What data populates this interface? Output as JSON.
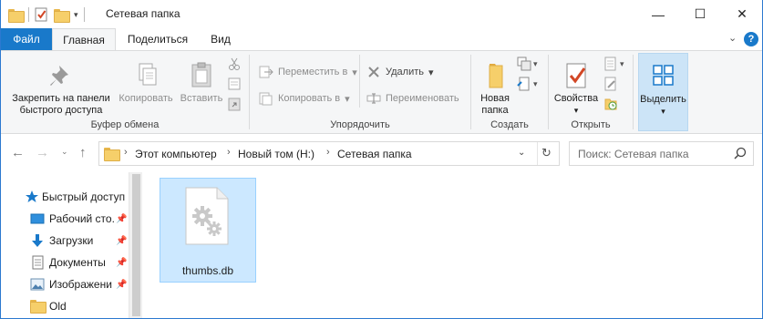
{
  "window": {
    "title": "Сетевая папка",
    "controls": {
      "minimize": "—",
      "maximize": "☐",
      "close": "✕"
    }
  },
  "ribbon": {
    "tabs": [
      "Файл",
      "Главная",
      "Поделиться",
      "Вид"
    ],
    "help_glyph": "?",
    "clipboard": {
      "pin": "Закрепить на панели быстрого доступа",
      "pin_line1": "Закрепить на панели",
      "pin_line2": "быстрого доступа",
      "copy": "Копировать",
      "paste": "Вставить",
      "label": "Буфер обмена"
    },
    "organize": {
      "move_to": "Переместить в",
      "copy_to": "Копировать в",
      "delete": "Удалить",
      "rename": "Переименовать",
      "label": "Упорядочить"
    },
    "new": {
      "new_folder_line1": "Новая",
      "new_folder_line2": "папка",
      "label": "Создать"
    },
    "open": {
      "properties": "Свойства",
      "label": "Открыть"
    },
    "select": {
      "select": "Выделить"
    }
  },
  "address": {
    "crumbs": [
      "Этот компьютер",
      "Новый том (H:)",
      "Сетевая папка"
    ],
    "search_placeholder": "Поиск: Сетевая папка"
  },
  "nav_pane": {
    "items": [
      {
        "label": "Быстрый доступ",
        "icon": "star-icon",
        "pinned": false
      },
      {
        "label": "Рабочий сто.",
        "icon": "desktop-icon",
        "pinned": true
      },
      {
        "label": "Загрузки",
        "icon": "download-icon",
        "pinned": true
      },
      {
        "label": "Документы",
        "icon": "documents-icon",
        "pinned": true
      },
      {
        "label": "Изображени",
        "icon": "pictures-icon",
        "pinned": true
      },
      {
        "label": "Old",
        "icon": "folder-icon",
        "pinned": false
      }
    ]
  },
  "files": [
    {
      "name": "thumbs.db",
      "icon": "system-file-icon",
      "selected": true
    }
  ],
  "colors": {
    "accent": "#1979ca",
    "selection": "#cce8ff",
    "folder": "#f6cf6a"
  }
}
